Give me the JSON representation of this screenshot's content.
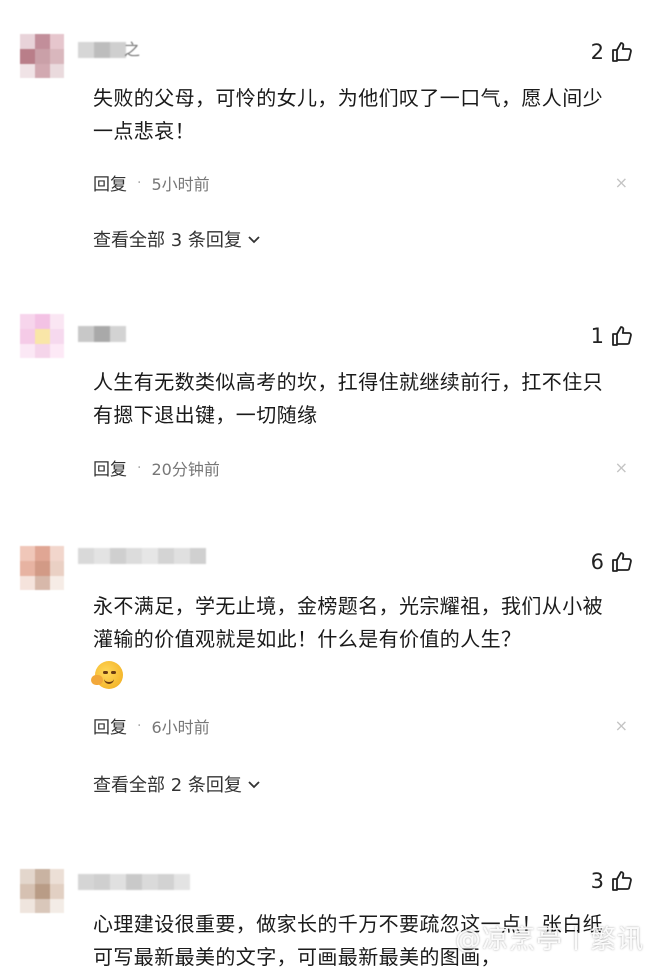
{
  "comments": [
    {
      "username_suffix": "之",
      "likes": "2",
      "text": "失败的父母，可怜的女儿，为他们叹了一口气，愿人间少一点悲哀！",
      "reply_label": "回复",
      "time": "5小时前",
      "view_all": "查看全部 3 条回复",
      "avatar_colors": [
        "#e8d3d9",
        "#c28e9a",
        "#e6c6cd",
        "#b97e89",
        "#caa0a8",
        "#d9b7bd",
        "#f0e3e6",
        "#d2a9b1",
        "#eadadd"
      ],
      "name_colors": [
        "#d6d6d6",
        "#bdbdbd",
        "#cfcfcf"
      ]
    },
    {
      "username_suffix": "",
      "likes": "1",
      "text": "人生有无数类似高考的坎，扛得住就继续前行，扛不住只有摁下退出键，一切随缘",
      "reply_label": "回复",
      "time": "20分钟前",
      "view_all": "",
      "avatar_colors": [
        "#f7d5ec",
        "#f3c2e4",
        "#fae6f3",
        "#f5cbe7",
        "#f9e6a8",
        "#f6d9ee",
        "#fbe8f5",
        "#f5d5ea",
        "#fde9f6"
      ],
      "name_colors": [
        "#c8c8c8",
        "#a9a9a9",
        "#d3d3d3"
      ]
    },
    {
      "username_suffix": "",
      "likes": "6",
      "text": "永不满足，学无止境，金榜题名，光宗耀祖，我们从小被灌输的价值观就是如此！什么是有价值的人生？",
      "reply_label": "回复",
      "time": "6小时前",
      "view_all": "查看全部 2 条回复",
      "avatar_colors": [
        "#f0c7b9",
        "#e0a694",
        "#f2d6cc",
        "#e7b3a2",
        "#d29a86",
        "#ead0c4",
        "#f5e3dc",
        "#d7b8aa",
        "#f6ece6"
      ],
      "name_colors": [
        "#d9d9d9",
        "#e3e3e3",
        "#cfcfcf",
        "#dcdcdc",
        "#e6e6e6",
        "#d4d4d4",
        "#e0e0e0",
        "#d0d0d0"
      ]
    },
    {
      "username_suffix": "",
      "likes": "3",
      "text": "心理建设很重要，做家长的千万不要疏忽这一点！张白纸可写最新最美的文字，可画最新最美的图画，",
      "reply_label": "",
      "time": "",
      "view_all": "",
      "avatar_colors": [
        "#e3d6cc",
        "#c9b3a2",
        "#ecdfd6",
        "#d6c1b2",
        "#b99c86",
        "#e2d0c3",
        "#efe5de",
        "#d9c7ba",
        "#f3ece6"
      ],
      "name_colors": [
        "#d5d5d5",
        "#cfcfcf",
        "#e0e0e0",
        "#c9c9c9",
        "#dadada",
        "#d2d2d2",
        "#e3e3e3"
      ]
    }
  ],
  "watermark": "@凉烹亭丨繁讯",
  "icons": {
    "thumb": "thumbs-up-icon",
    "close": "close-icon",
    "chevron": "chevron-down-icon",
    "emoji": "smirk-emoji-icon"
  }
}
